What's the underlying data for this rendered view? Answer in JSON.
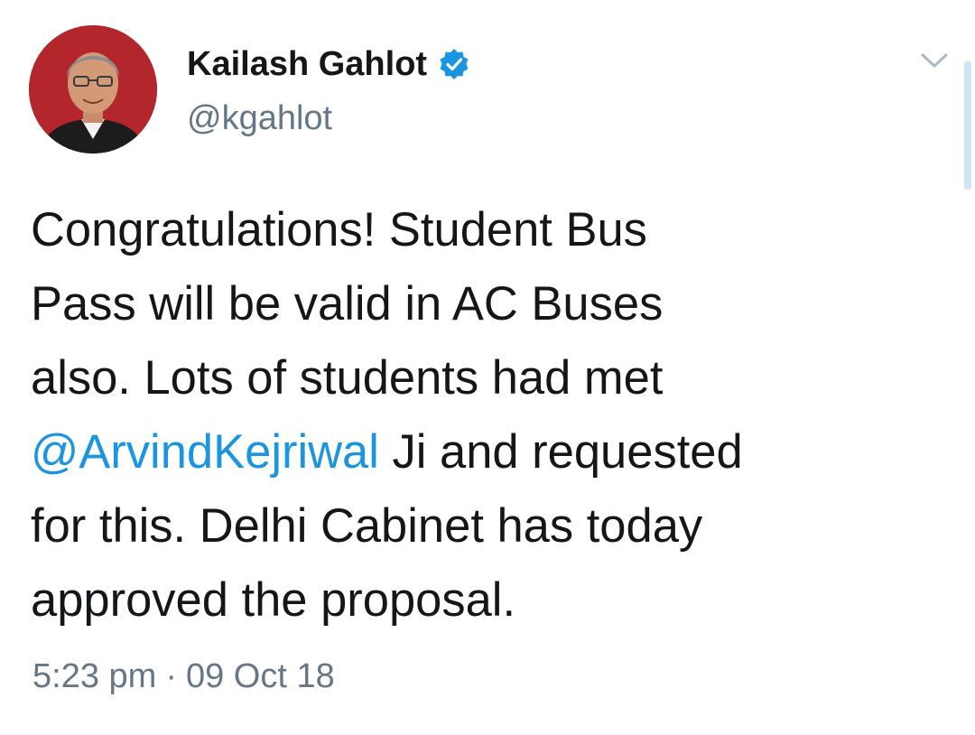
{
  "user": {
    "display_name": "Kailash Gahlot",
    "handle": "@kgahlot",
    "verified_icon": "verified-badge-icon"
  },
  "tweet": {
    "line1": "Congratulations! Student Bus",
    "line2": "Pass will be valid in AC Buses",
    "line3": "also. Lots of students had met",
    "mention": "@ArvindKejriwal",
    "line4_rest": " Ji and requested",
    "line5": "for this. Delhi Cabinet has today",
    "line6": "approved the proposal."
  },
  "meta": {
    "time": "5:23 pm",
    "separator": "·",
    "date": "09 Oct 18"
  },
  "colors": {
    "accent": "#1b95e0",
    "secondary_text": "#657786",
    "primary_text": "#14171a",
    "avatar_bg": "#b2262c"
  },
  "icons": {
    "menu": "chevron-down-icon"
  }
}
